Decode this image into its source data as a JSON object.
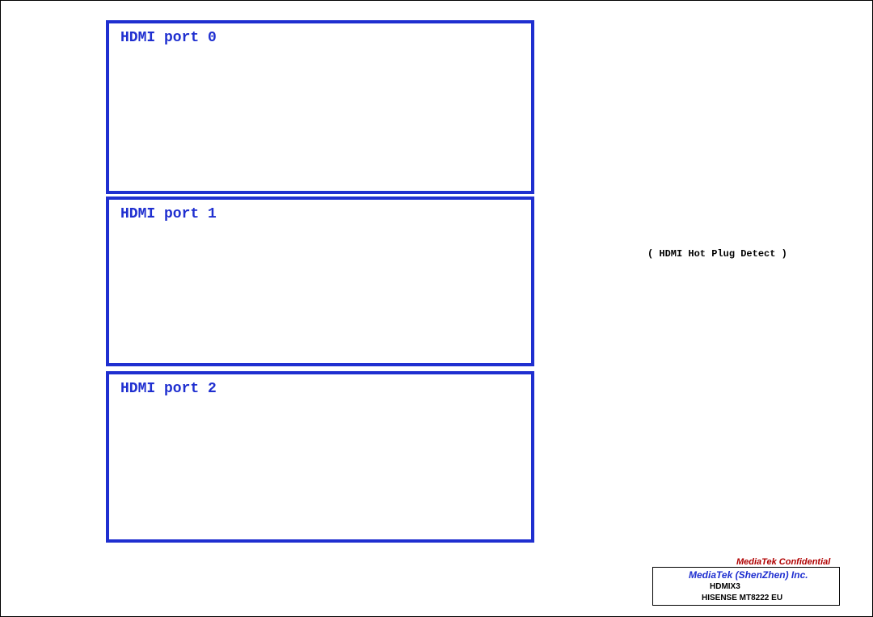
{
  "panels": [
    {
      "title": "HDMI port 0"
    },
    {
      "title": "HDMI port 1"
    },
    {
      "title": "HDMI port 2"
    }
  ],
  "hotplug_label": "( HDMI Hot Plug Detect )",
  "title_block": {
    "confidential": "MediaTek Confidential",
    "company": "MediaTek (ShenZhen) Inc.",
    "sheet_title": "HDMIX3",
    "doc_number": "HISENSE MT8222 EU"
  },
  "colors": {
    "panel_border": "#1f2fd0",
    "title_text": "#1f2fd0"
  }
}
